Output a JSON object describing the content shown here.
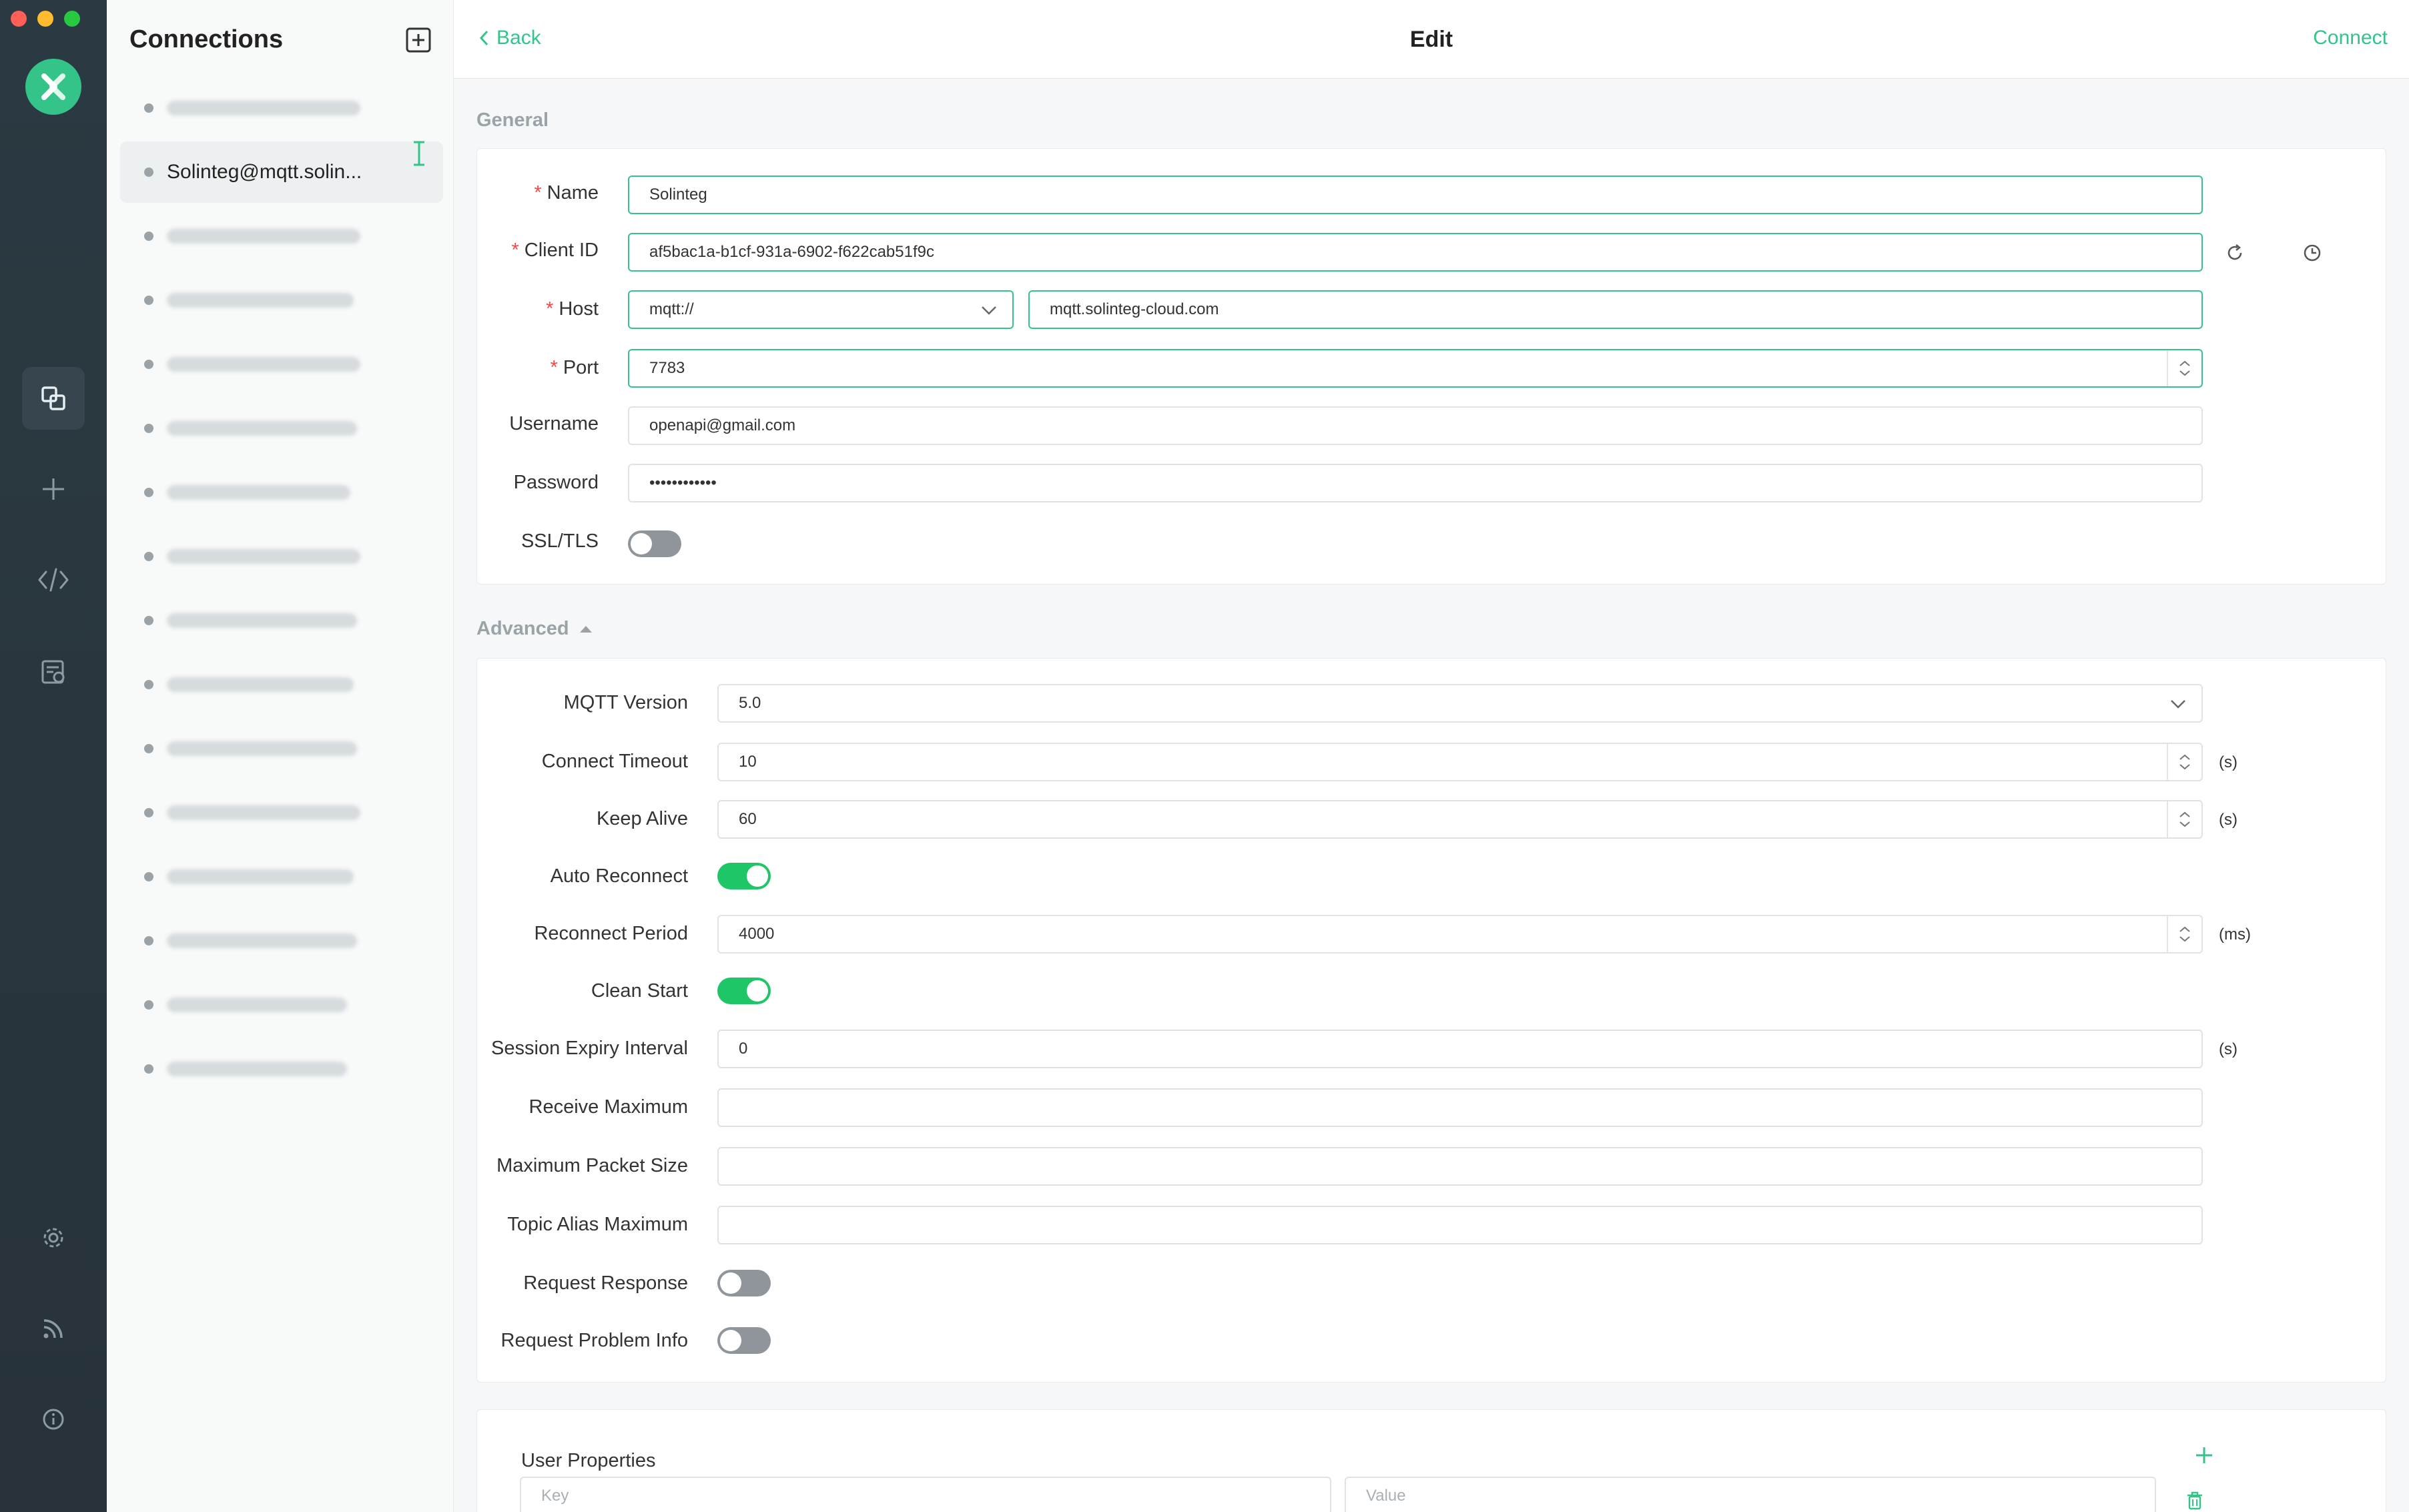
{
  "window": {
    "traffic_colors": [
      "#ff5f57",
      "#febc2e",
      "#28c840"
    ]
  },
  "sidebar": {
    "title": "Connections",
    "active_connection": "Solinteg@mqtt.solin...",
    "blurred_rows": 15
  },
  "header": {
    "back_label": "Back",
    "title": "Edit",
    "connect_label": "Connect"
  },
  "general": {
    "section_title": "General",
    "name_label": "Name",
    "name_value": "Solinteg",
    "client_id_label": "Client ID",
    "client_id_value": "af5bac1a-b1cf-931a-6902-f622cab51f9c",
    "host_label": "Host",
    "protocol_value": "mqtt://",
    "host_value": "mqtt.solinteg-cloud.com",
    "port_label": "Port",
    "port_value": "7783",
    "username_label": "Username",
    "username_value": "openapi@gmail.com",
    "password_label": "Password",
    "password_value": "••••••••••••",
    "ssl_label": "SSL/TLS",
    "ssl_on": false
  },
  "advanced": {
    "section_title": "Advanced",
    "mqtt_version_label": "MQTT Version",
    "mqtt_version_value": "5.0",
    "connect_timeout_label": "Connect Timeout",
    "connect_timeout_value": "10",
    "connect_timeout_unit": "(s)",
    "keep_alive_label": "Keep Alive",
    "keep_alive_value": "60",
    "keep_alive_unit": "(s)",
    "auto_reconnect_label": "Auto Reconnect",
    "auto_reconnect_on": true,
    "reconnect_period_label": "Reconnect Period",
    "reconnect_period_value": "4000",
    "reconnect_period_unit": "(ms)",
    "clean_start_label": "Clean Start",
    "clean_start_on": true,
    "session_expiry_label": "Session Expiry Interval",
    "session_expiry_value": "0",
    "session_expiry_unit": "(s)",
    "receive_maximum_label": "Receive Maximum",
    "receive_maximum_value": "",
    "max_packet_size_label": "Maximum Packet Size",
    "max_packet_size_value": "",
    "topic_alias_max_label": "Topic Alias Maximum",
    "topic_alias_max_value": "",
    "request_response_label": "Request Response",
    "request_response_on": false,
    "request_problem_info_label": "Request Problem Info",
    "request_problem_info_on": false
  },
  "user_properties": {
    "title": "User Properties",
    "key_placeholder": "Key",
    "value_placeholder": "Value"
  },
  "colors": {
    "accent": "#34c388",
    "required": "#f04a4a",
    "toggle_on": "#1fc668",
    "toggle_off": "#8f959a"
  },
  "icons": [
    "mqttx-logo-icon",
    "connections-icon",
    "plus-icon",
    "code-icon",
    "log-icon",
    "gear-icon",
    "rss-icon",
    "info-icon",
    "add-connection-icon",
    "chevron-left-icon",
    "refresh-icon",
    "clock-icon",
    "chevron-down-icon",
    "caret-up-icon",
    "trash-icon",
    "text-cursor-icon"
  ]
}
